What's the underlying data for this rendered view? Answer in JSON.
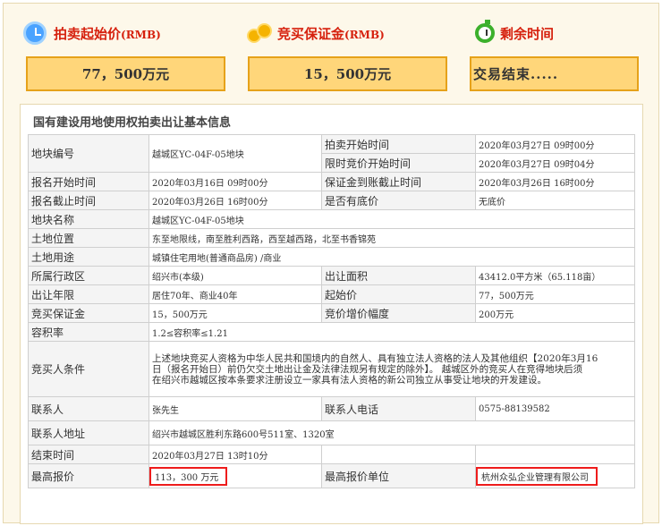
{
  "header": {
    "start_price": {
      "label": "拍卖起始价",
      "unit": "(RMB)",
      "value": "77，500万元",
      "icon": "clock-icon"
    },
    "deposit": {
      "label": "竞买保证金",
      "unit": "(RMB)",
      "value": "15，500万元",
      "icon": "coins-icon"
    },
    "remaining": {
      "label": "剩余时间",
      "value": "交易结束.....",
      "icon": "timer-icon"
    }
  },
  "panel": {
    "title": "国有建设用地使用权拍卖出让基本信息",
    "rows": {
      "plot_no_label": "地块编号",
      "plot_no": "越城区YC-04F-05地块",
      "auction_start_label": "拍卖开始时间",
      "auction_start": "2020年03月27日 09时00分",
      "bid_start_label": "限时竞价开始时间",
      "bid_start": "2020年03月27日 09时04分",
      "reg_start_label": "报名开始时间",
      "reg_start": "2020年03月16日 09时00分",
      "deposit_deadline_label": "保证金到账截止时间",
      "deposit_deadline": "2020年03月26日 16时00分",
      "reg_end_label": "报名截止时间",
      "reg_end": "2020年03月26日 16时00分",
      "reserve_label": "是否有底价",
      "reserve": "无底价",
      "name_label": "地块名称",
      "name": "越城区YC-04F-05地块",
      "location_label": "土地位置",
      "location": "东至地限线，南至胜利西路，西至越西路，北至书香锦苑",
      "use_label": "土地用途",
      "use": "城镇住宅用地(普通商品房) /商业",
      "district_label": "所属行政区",
      "district": "绍兴市(本级)",
      "area_label": "出让面积",
      "area": "43412.0平方米（65.118亩）",
      "term_label": "出让年限",
      "term": "居住70年、商业40年",
      "start_price_label": "起始价",
      "start_price": "77，500万元",
      "deposit_label": "竞买保证金",
      "deposit": "15，500万元",
      "increment_label": "竞价增价幅度",
      "increment": "200万元",
      "far_label": "容积率",
      "far": "1.2≤容积率≤1.21",
      "bidder_label": "竞买人条件",
      "bidder_line1": "上述地块竞买人资格为中华人民共和国境内的自然人、具有独立法人资格的法人及其他组织【2020年3月16",
      "bidder_line2": "日（报名开始日）前仍欠交土地出让金及法律法规另有规定的除外】。 越城区外的竞买人在竞得地块后须",
      "bidder_line3": "在绍兴市越城区按本条要求注册设立一家具有法人资格的新公司独立从事受让地块的开发建设。",
      "contact_label": "联系人",
      "contact": "张先生",
      "phone_label": "联系人电话",
      "phone": "0575-88139582",
      "address_label": "联系人地址",
      "address": "绍兴市越城区胜利东路600号511室、1320室",
      "end_time_label": "结束时间",
      "end_time": "2020年03月27日 13时10分",
      "top_bid_label": "最高报价",
      "top_bid": "113，300 万元",
      "top_bidder_label": "最高报价单位",
      "top_bidder": "杭州众弘企业管理有限公司"
    }
  },
  "colors": {
    "accent_red": "#d6200d",
    "box_fill": "#ffd67a",
    "box_border": "#e6a21a",
    "highlight_border": "#ee1c1c"
  }
}
